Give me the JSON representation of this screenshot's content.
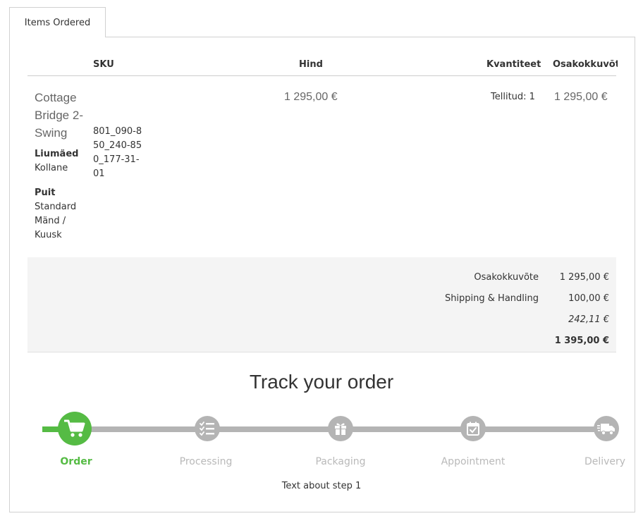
{
  "tab": {
    "label": "Items Ordered"
  },
  "table": {
    "headers": {
      "sku": "SKU",
      "price": "Hind",
      "qty": "Kvantiteet",
      "subtotal": "Osakokkuvõte"
    }
  },
  "item": {
    "name": "Cottage Bridge 2-Swing",
    "options": [
      {
        "label": "Liumäed",
        "value": "Kollane"
      },
      {
        "label": "Puit",
        "value": "Standard Mänd / Kuusk"
      }
    ],
    "sku": "801_090-850_240-850_177-31-01",
    "price": "1 295,00 €",
    "qty": "Tellitud: 1",
    "subtotal": "1 295,00 €"
  },
  "totals": {
    "subtotal_label": "Osakokkuvõte",
    "subtotal_value": "1 295,00 €",
    "shipping_label": "Shipping & Handling",
    "shipping_value": "100,00 €",
    "tax_value": "242,11 €",
    "grand_total_value": "1 395,00 €"
  },
  "tracking": {
    "title": "Track your order",
    "progress_fraction": 0.0,
    "active_color": "#55bb44",
    "inactive_color": "#b4b4b4",
    "steps": [
      {
        "label": "Order",
        "icon": "shopping-cart-icon",
        "active": true
      },
      {
        "label": "Processing",
        "icon": "checklist-icon",
        "active": false
      },
      {
        "label": "Packaging",
        "icon": "gift-icon",
        "active": false
      },
      {
        "label": "Appointment",
        "icon": "calendar-check-icon",
        "active": false
      },
      {
        "label": "Delivery",
        "icon": "truck-icon",
        "active": false
      }
    ],
    "step_text": "Text about step 1"
  }
}
